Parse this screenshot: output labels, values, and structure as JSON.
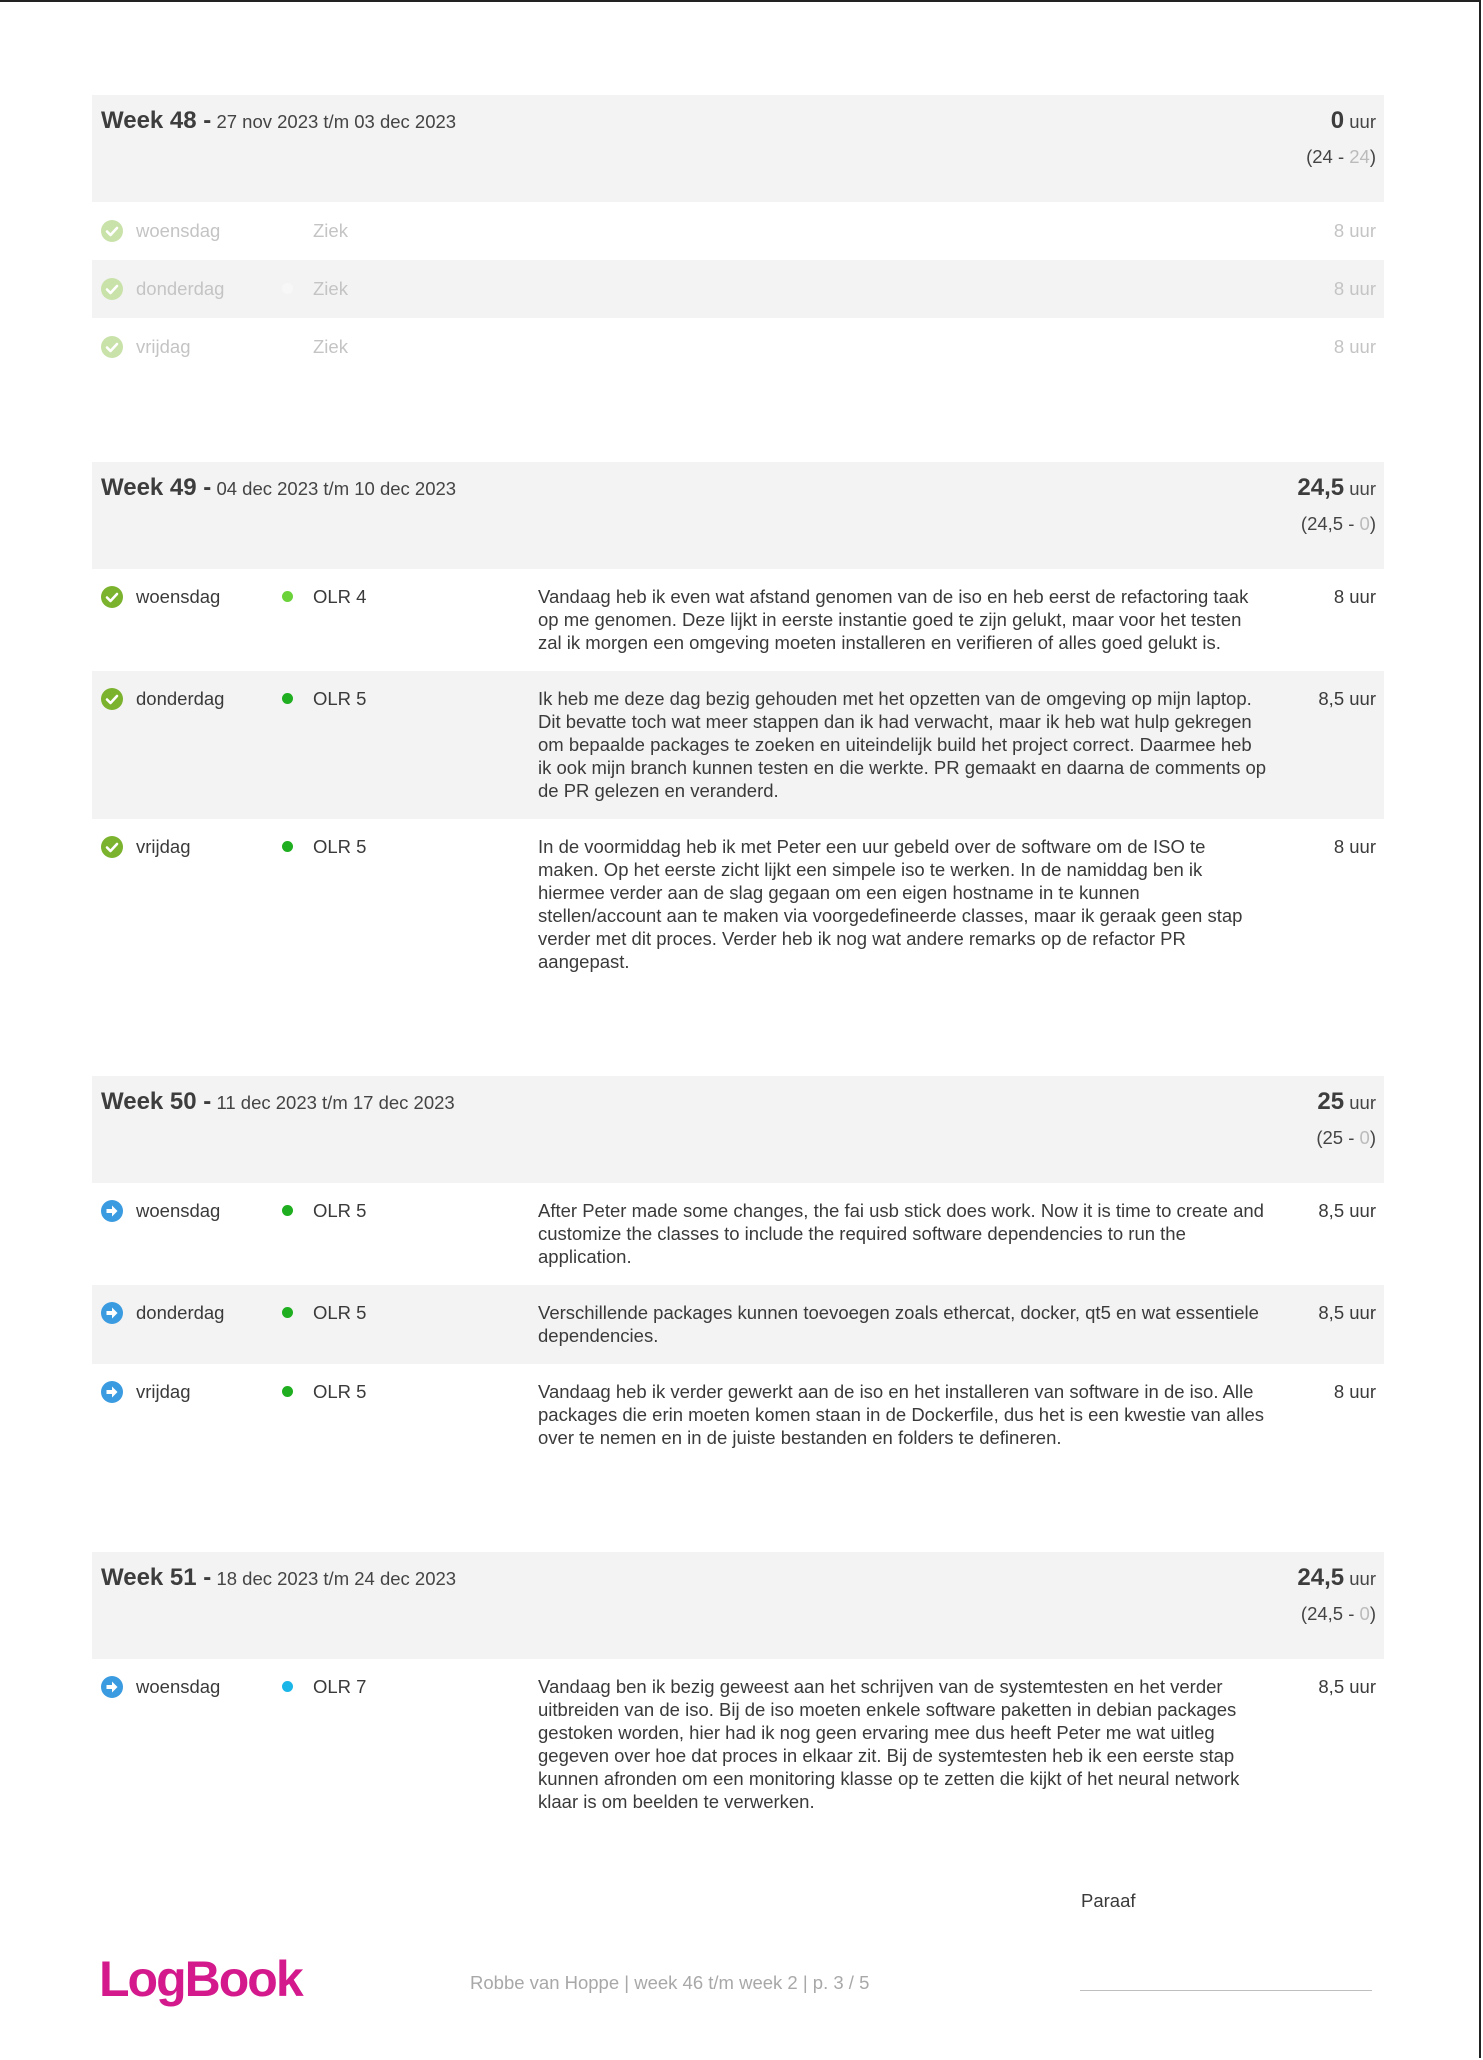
{
  "weeks": [
    {
      "label": "Week 48 -",
      "range": "27 nov 2023 t/m 03 dec 2023",
      "total": "0",
      "unit": "uur",
      "balance_open": "(24 - ",
      "balance_sub": "24",
      "balance_close": ")",
      "days": [
        {
          "status": "check",
          "day": "woensdag",
          "dot_color": "",
          "code": "Ziek",
          "text": "",
          "hours": "8 uur"
        },
        {
          "status": "check",
          "day": "donderdag",
          "dot_color": "#f7f7f7",
          "code": "Ziek",
          "text": "",
          "hours": "8 uur"
        },
        {
          "status": "check",
          "day": "vrijdag",
          "dot_color": "",
          "code": "Ziek",
          "text": "",
          "hours": "8 uur"
        }
      ]
    },
    {
      "label": "Week 49 -",
      "range": "04 dec 2023 t/m 10 dec 2023",
      "total": "24,5",
      "unit": "uur",
      "balance_open": "(24,5 - ",
      "balance_sub": "0",
      "balance_close": ")",
      "days": [
        {
          "status": "check",
          "day": "woensdag",
          "dot_color": "#6bd23a",
          "code": "OLR 4",
          "text": "Vandaag heb ik even wat afstand genomen van de iso en heb eerst de refactoring taak op me genomen. Deze lijkt in eerste instantie goed te zijn gelukt, maar voor het testen zal ik morgen een omgeving moeten installeren en verifieren of alles goed gelukt is.",
          "hours": "8 uur"
        },
        {
          "status": "check",
          "day": "donderdag",
          "dot_color": "#1fae1f",
          "code": "OLR 5",
          "text": "Ik heb me deze dag bezig gehouden met het opzetten van de omgeving op mijn laptop. Dit bevatte toch wat meer stappen dan ik had verwacht, maar ik heb wat hulp gekregen om bepaalde packages te zoeken en uiteindelijk build het project correct. Daarmee heb ik ook mijn branch kunnen testen en die werkte. PR gemaakt en daarna de comments op de PR gelezen en veranderd.",
          "hours": "8,5 uur"
        },
        {
          "status": "check",
          "day": "vrijdag",
          "dot_color": "#1fae1f",
          "code": "OLR 5",
          "text": "In de voormiddag heb ik met Peter een uur gebeld over de software om de ISO te maken. Op het eerste zicht lijkt een simpele iso te werken. In de namiddag ben ik hiermee verder aan de slag gegaan om een eigen hostname in te kunnen stellen/account aan te maken via voorgedefineerde classes, maar ik geraak geen stap verder met dit proces. Verder heb ik nog wat andere remarks op de refactor PR aangepast.",
          "hours": "8 uur"
        }
      ]
    },
    {
      "label": "Week 50 -",
      "range": "11 dec 2023 t/m 17 dec 2023",
      "total": "25",
      "unit": "uur",
      "balance_open": "(25 - ",
      "balance_sub": "0",
      "balance_close": ")",
      "days": [
        {
          "status": "arrow",
          "day": "woensdag",
          "dot_color": "#1fae1f",
          "code": "OLR 5",
          "text": "After Peter made some changes, the fai usb stick does work. Now it is time to create and customize the classes to include the required software dependencies to run the application.",
          "hours": "8,5 uur"
        },
        {
          "status": "arrow",
          "day": "donderdag",
          "dot_color": "#1fae1f",
          "code": "OLR 5",
          "text": "Verschillende packages kunnen toevoegen zoals ethercat, docker, qt5 en wat essentiele dependencies.",
          "hours": "8,5 uur"
        },
        {
          "status": "arrow",
          "day": "vrijdag",
          "dot_color": "#1fae1f",
          "code": "OLR 5",
          "text": "Vandaag heb ik verder gewerkt aan de iso en het installeren van software in de iso. Alle packages die erin moeten komen staan in de Dockerfile, dus het is een kwestie van alles over te nemen en in de juiste bestanden en folders te defineren.",
          "hours": "8 uur"
        }
      ]
    },
    {
      "label": "Week 51 -",
      "range": "18 dec 2023 t/m 24 dec 2023",
      "total": "24,5",
      "unit": "uur",
      "balance_open": "(24,5 - ",
      "balance_sub": "0",
      "balance_close": ")",
      "days": [
        {
          "status": "arrow",
          "day": "woensdag",
          "dot_color": "#1bb6e8",
          "code": "OLR 7",
          "text": "Vandaag ben ik bezig geweest aan het schrijven van de systemtesten en het verder uitbreiden van de iso. Bij de iso moeten enkele software paketten in debian packages gestoken worden, hier had ik nog geen ervaring mee dus heeft Peter me wat uitleg gegeven over hoe dat proces in elkaar zit. Bij de systemtesten heb ik een eerste stap kunnen afronden om een monitoring klasse op te zetten die kijkt of het neural network klaar is om beelden te verwerken.",
          "hours": "8,5 uur"
        }
      ]
    }
  ],
  "footer": {
    "paraaf": "Paraaf",
    "logo": "LogBook",
    "text": "Robbe van Hoppe | week 46 t/m week 2 | p. 3 / 5"
  },
  "colors": {
    "logo": "#d4198c",
    "check_icon": "#7cb32e",
    "check_icon_dim": "#c9e2a9",
    "arrow_icon": "#3b9be0"
  }
}
